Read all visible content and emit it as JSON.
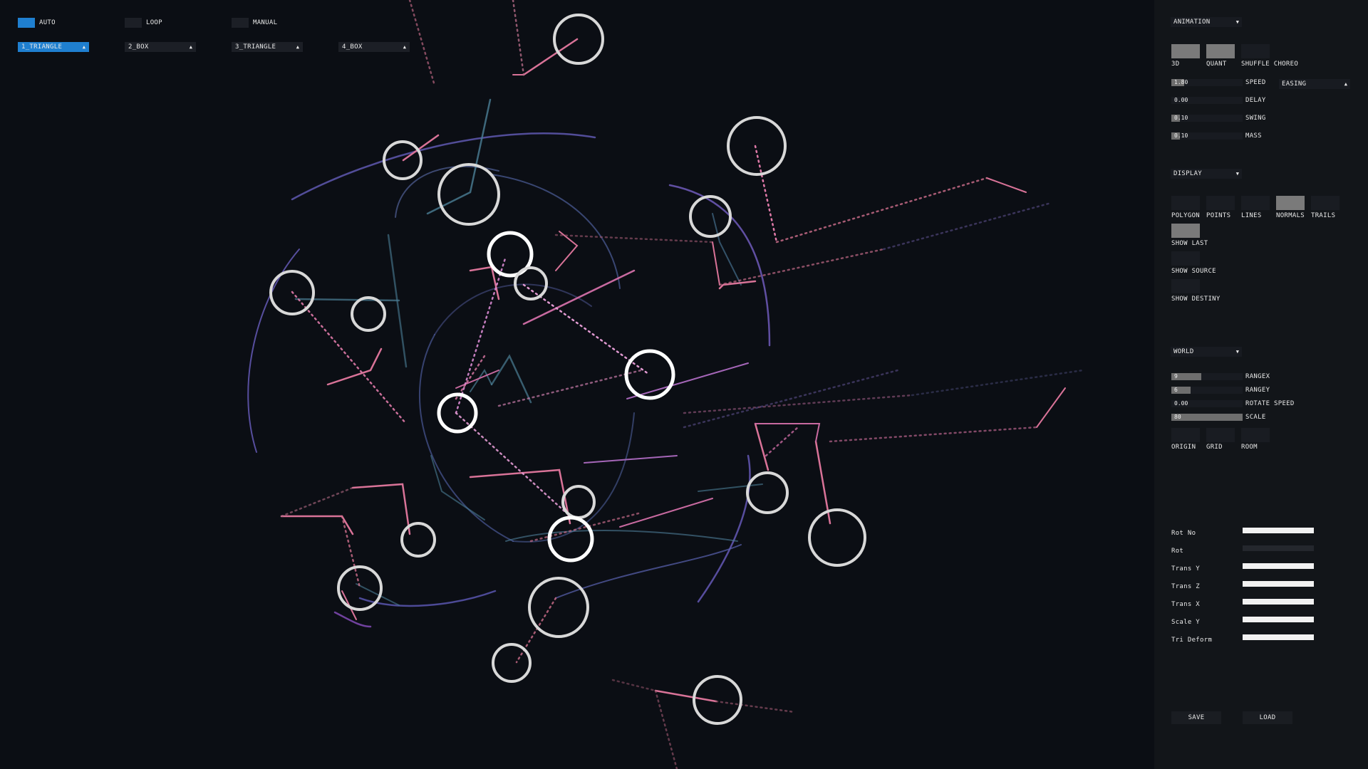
{
  "modes": {
    "toggles": [
      {
        "label": "AUTO",
        "active": true
      },
      {
        "label": "LOOP",
        "active": false
      },
      {
        "label": "MANUAL",
        "active": false
      }
    ],
    "dropdowns": [
      {
        "label": "1_TRIANGLE",
        "active": true
      },
      {
        "label": "2_BOX",
        "active": false
      },
      {
        "label": "3_TRIANGLE",
        "active": false
      },
      {
        "label": "4_BOX",
        "active": false
      }
    ]
  },
  "panel": {
    "animation": {
      "header": "ANIMATION",
      "toggles": [
        {
          "label": "3D",
          "on": true
        },
        {
          "label": "QUANT",
          "on": true
        },
        {
          "label": "SHUFFLE CHOREO",
          "on": false
        }
      ],
      "sliders": [
        {
          "label": "SPEED",
          "value": "1.80",
          "fraction": 0.18
        },
        {
          "label": "DELAY",
          "value": "0.00",
          "fraction": 0.0
        },
        {
          "label": "SWING",
          "value": "0.10",
          "fraction": 0.12
        },
        {
          "label": "MASS",
          "value": "0.10",
          "fraction": 0.12
        }
      ],
      "easing": "EASING"
    },
    "display": {
      "header": "DISPLAY",
      "toggles": [
        {
          "label": "POLYGON",
          "on": false
        },
        {
          "label": "POINTS",
          "on": false
        },
        {
          "label": "LINES",
          "on": false
        },
        {
          "label": "NORMALS",
          "on": true
        },
        {
          "label": "TRAILS",
          "on": false
        },
        {
          "label": "SHOW LAST",
          "on": true
        },
        {
          "label": "SHOW SOURCE",
          "on": false
        },
        {
          "label": "SHOW DESTINY",
          "on": false
        }
      ]
    },
    "world": {
      "header": "WORLD",
      "sliders": [
        {
          "label": "RANGEX",
          "value": "9",
          "fraction": 0.42
        },
        {
          "label": "RANGEY",
          "value": "6",
          "fraction": 0.27
        },
        {
          "label": "ROTATE SPEED",
          "value": "0.00",
          "fraction": 0.0
        },
        {
          "label": "SCALE",
          "value": "80",
          "fraction": 1.0
        }
      ],
      "toggles": [
        {
          "label": "ORIGIN",
          "on": false
        },
        {
          "label": "GRID",
          "on": false
        },
        {
          "label": "ROOM",
          "on": false
        }
      ]
    },
    "channels": [
      {
        "label": "Rot No",
        "on": true
      },
      {
        "label": "Rot",
        "on": false
      },
      {
        "label": "Trans Y",
        "on": true
      },
      {
        "label": "Trans Z",
        "on": true
      },
      {
        "label": "Trans X",
        "on": true
      },
      {
        "label": "Scale Y",
        "on": true
      },
      {
        "label": "Tri Deform",
        "on": true
      }
    ],
    "save_label": "SAVE",
    "load_label": "LOAD"
  },
  "colors": {
    "bg": "#0b0e14",
    "panel": "#121519",
    "accent": "#1f7fd0",
    "pink": "#e07aa8",
    "violet": "#7a64c8",
    "teal": "#4b7f96"
  }
}
